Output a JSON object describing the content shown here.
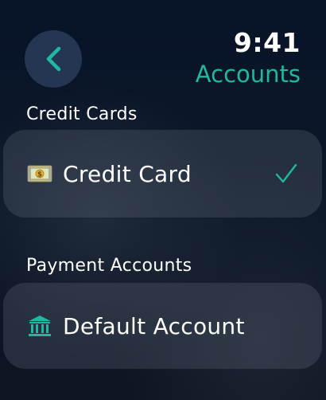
{
  "header": {
    "back_icon": "chevron-left-icon",
    "time": "9:41",
    "title": "Accounts"
  },
  "sections": [
    {
      "title": "Credit Cards",
      "items": [
        {
          "icon": "money-icon",
          "label": "Credit Card",
          "selected": true
        }
      ]
    },
    {
      "title": "Payment Accounts",
      "items": [
        {
          "icon": "bank-icon",
          "label": "Default Account",
          "selected": false
        }
      ]
    }
  ],
  "colors": {
    "accent": "#1fb8a0",
    "background": "#0b1627",
    "row_background": "#2b333e"
  }
}
